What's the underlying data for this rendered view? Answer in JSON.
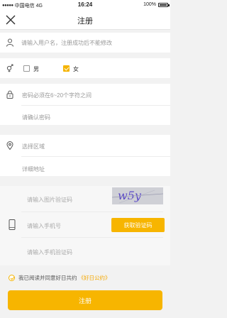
{
  "status_bar": {
    "carrier": "中国电信",
    "network": "4G",
    "time": "16:24",
    "battery": "100%"
  },
  "nav": {
    "title": "注册",
    "close_icon": "close-icon"
  },
  "form": {
    "username_placeholder": "请输入用户名，注册成功后不能修改",
    "gender": {
      "male_label": "男",
      "female_label": "女",
      "selected": "女"
    },
    "password_placeholder": "密码必须在6~20个字符之间",
    "confirm_password_placeholder": "请确认密码",
    "region_placeholder": "选择区域",
    "address_placeholder": "详细地址",
    "image_captcha_placeholder": "请输入图片验证码",
    "captcha_text": "w5y",
    "phone_placeholder": "请输入手机号",
    "get_code_label": "获取验证码",
    "sms_code_placeholder": "请输入手机验证码"
  },
  "agreement": {
    "prefix": "我已阅读并同意好日共约",
    "link": "《好日公约》",
    "checked": true
  },
  "submit_label": "注册",
  "colors": {
    "accent": "#f7b500",
    "background": "#f2f2f2"
  }
}
